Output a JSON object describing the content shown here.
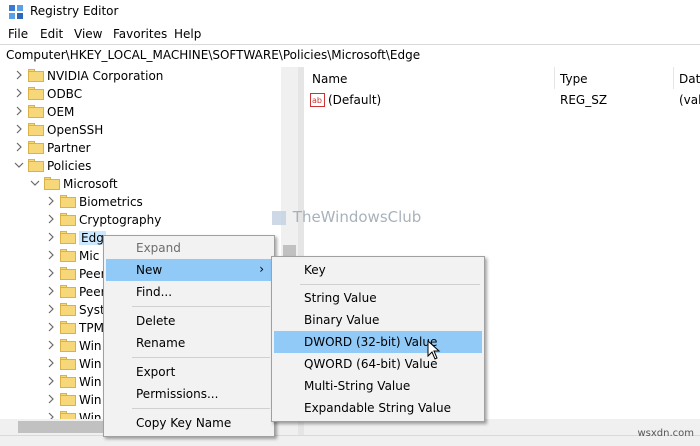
{
  "window": {
    "title": "Registry Editor"
  },
  "menu": [
    "File",
    "Edit",
    "View",
    "Favorites",
    "Help"
  ],
  "address": "Computer\\HKEY_LOCAL_MACHINE\\SOFTWARE\\Policies\\Microsoft\\Edge",
  "tree": [
    {
      "label": "NVIDIA Corporation",
      "level": 1,
      "expanded": false
    },
    {
      "label": "ODBC",
      "level": 1,
      "expanded": false
    },
    {
      "label": "OEM",
      "level": 1,
      "expanded": false
    },
    {
      "label": "OpenSSH",
      "level": 1,
      "expanded": false
    },
    {
      "label": "Partner",
      "level": 1,
      "expanded": false
    },
    {
      "label": "Policies",
      "level": 1,
      "expanded": true
    },
    {
      "label": "Microsoft",
      "level": 2,
      "expanded": true
    },
    {
      "label": "Biometrics",
      "level": 3,
      "expanded": false
    },
    {
      "label": "Cryptography",
      "level": 3,
      "expanded": false
    },
    {
      "label": "Edg",
      "level": 3,
      "expanded": false,
      "selected": true
    },
    {
      "label": "Mic",
      "level": 3,
      "expanded": false
    },
    {
      "label": "Peer",
      "level": 3,
      "expanded": false
    },
    {
      "label": "Peer",
      "level": 3,
      "expanded": false
    },
    {
      "label": "Syst",
      "level": 3,
      "expanded": false
    },
    {
      "label": "TPM",
      "level": 3,
      "expanded": false
    },
    {
      "label": "Win",
      "level": 3,
      "expanded": false
    },
    {
      "label": "Win",
      "level": 3,
      "expanded": false
    },
    {
      "label": "Win",
      "level": 3,
      "expanded": false
    },
    {
      "label": "Win",
      "level": 3,
      "expanded": false
    },
    {
      "label": "Win",
      "level": 3,
      "expanded": false
    }
  ],
  "list": {
    "columns": [
      "Name",
      "Type",
      "Dat"
    ],
    "rows": [
      {
        "name": "(Default)",
        "type": "REG_SZ",
        "data": "(val"
      }
    ]
  },
  "context_menu": {
    "items": [
      {
        "label": "Expand",
        "disabled": true
      },
      {
        "label": "New",
        "submenu": true
      },
      {
        "label": "Find..."
      },
      {
        "label": "Delete"
      },
      {
        "label": "Rename"
      },
      {
        "label": "Export"
      },
      {
        "label": "Permissions..."
      },
      {
        "label": "Copy Key Name"
      }
    ]
  },
  "submenu": {
    "items": [
      "Key",
      "String Value",
      "Binary Value",
      "DWORD (32-bit) Value",
      "QWORD (64-bit) Value",
      "Multi-String Value",
      "Expandable String Value"
    ],
    "highlighted": "DWORD (32-bit) Value"
  },
  "watermark": "TheWindowsClub",
  "footer": "wsxdn.com",
  "colors": {
    "highlight": "#91c9f7",
    "folder": "#f6d77a",
    "menu_bg": "#f2f2f2"
  }
}
